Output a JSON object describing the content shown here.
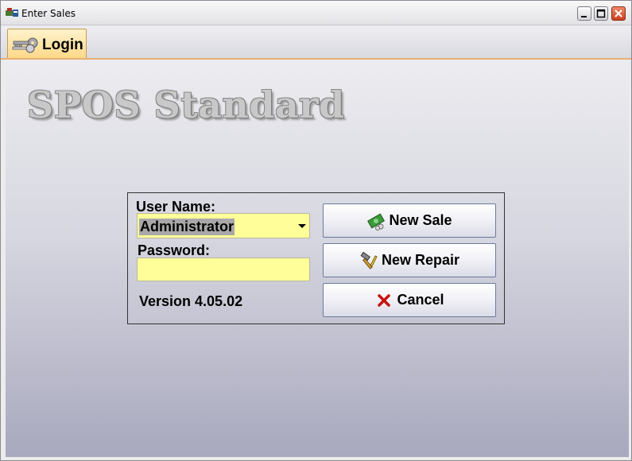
{
  "window": {
    "title": "Enter Sales"
  },
  "tabs": [
    {
      "label": "Login"
    }
  ],
  "app_title": "SPOS Standard",
  "login": {
    "username_label": "User Name:",
    "username_value": "Administrator",
    "password_label": "Password:",
    "password_value": "",
    "version": "Version 4.05.02"
  },
  "buttons": {
    "new_sale": "New Sale",
    "new_repair": "New Repair",
    "cancel": "Cancel"
  },
  "colors": {
    "field_background": "#fffe99",
    "tab_background": "#ffd889",
    "cancel_icon": "#c81010"
  }
}
